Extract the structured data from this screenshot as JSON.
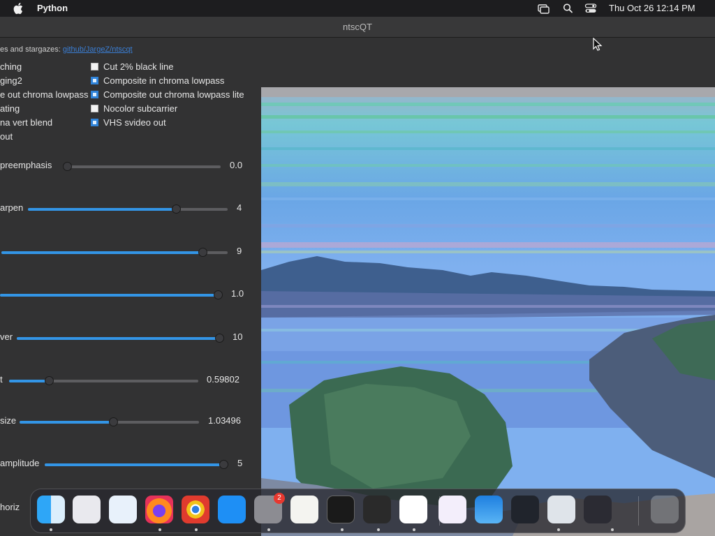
{
  "menubar": {
    "app_name": "Python",
    "clock": "Thu Oct 26  12:14 PM"
  },
  "window": {
    "title": "ntscQT"
  },
  "info": {
    "prefix": "es and stargazes: ",
    "link": "github/JargeZ/ntscqt"
  },
  "left_checkbox_labels": [
    "ching",
    "ging2",
    "e out chroma lowpass",
    "ating",
    "na vert blend",
    "out"
  ],
  "checkboxes": [
    {
      "label": "Cut 2% black line",
      "checked": false
    },
    {
      "label": "Composite in chroma lowpass",
      "checked": true
    },
    {
      "label": "Composite out chroma lowpass lite",
      "checked": true
    },
    {
      "label": "Nocolor subcarrier",
      "checked": false
    },
    {
      "label": "VHS svideo out",
      "checked": true
    }
  ],
  "sliders": [
    {
      "label": "preemphasis",
      "value": "0.0",
      "fraction": 0.0
    },
    {
      "label": "arpen",
      "value": "4",
      "fraction": 0.74
    },
    {
      "label": "",
      "value": "9",
      "fraction": 0.89
    },
    {
      "label": "",
      "value": "1.0",
      "fraction": 1.0
    },
    {
      "label": "ver",
      "value": "10",
      "fraction": 1.0
    },
    {
      "label": "t",
      "value": "0.59802",
      "fraction": 0.21
    },
    {
      "label": "size",
      "value": "1.03496",
      "fraction": 0.52
    },
    {
      "label": "amplitude",
      "value": "5",
      "fraction": 1.0
    }
  ],
  "partial_label": "horiz",
  "dock": {
    "apps": [
      "finder",
      "launchpad",
      "safari",
      "firefox",
      "chrome",
      "app-store",
      "system-settings",
      "textedit",
      "terminal",
      "garageband",
      "vscode",
      "visual-studio",
      "weather",
      "rocket",
      "quicktime",
      "istat-menus",
      "trash"
    ],
    "settings_badge": "2"
  },
  "colors": {
    "accent": "#3395e6",
    "checkbox_checked": "#2f83d9"
  }
}
